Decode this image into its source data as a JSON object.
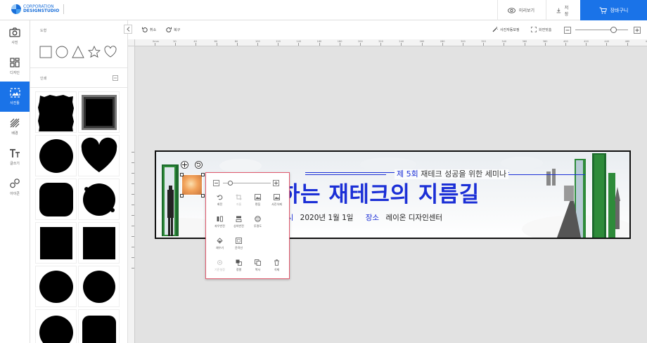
{
  "header": {
    "logo_line1": "CORPORATION",
    "logo_line2": "DESIGNSTUDIO",
    "preview_label": "미리보기",
    "save_label": "저장",
    "cart_label": "장바구니"
  },
  "nav": {
    "items": [
      {
        "label": "사진",
        "icon": "camera-icon"
      },
      {
        "label": "디자인",
        "icon": "layout-grid-icon"
      },
      {
        "label": "사진틀",
        "icon": "photo-frame-icon",
        "active": true
      },
      {
        "label": "배경",
        "icon": "background-pattern-icon"
      },
      {
        "label": "글쓰기",
        "icon": "text-icon"
      },
      {
        "label": "아이콘",
        "icon": "shapes-icon"
      }
    ]
  },
  "panel": {
    "shapes_header": "도형",
    "frames_header": "인쇄"
  },
  "toolbar": {
    "undo_label": "취소",
    "redo_label": "복구",
    "auto_correct_label": "사진자동보정",
    "fit_label": "화면맞춤",
    "zoom_level": 0.73
  },
  "ruler": {
    "marks": [
      "0mm",
      "20",
      "40",
      "60",
      "80",
      "100",
      "120",
      "140",
      "160",
      "180",
      "200",
      "220",
      "240",
      "260",
      "280",
      "300",
      "320",
      "340",
      "360",
      "380",
      "400",
      "420",
      "440",
      "460",
      "480"
    ]
  },
  "banner": {
    "edition_prefix": "제 5회",
    "edition_rest": "재테크 성공을 위한 세미나",
    "headline": "하는 재테크의 지름길",
    "date_label": "일시",
    "date_value": "2020년 1월 1일",
    "place_label": "장소",
    "place_value": "레이온 디자인센터"
  },
  "context_menu": {
    "opacity_level": 0.15,
    "items": [
      {
        "label": "회전",
        "icon": "rotate-icon",
        "enabled": true
      },
      {
        "label": "자름",
        "icon": "crop-icon",
        "enabled": false
      },
      {
        "label": "편집",
        "icon": "image-edit-icon",
        "enabled": true
      },
      {
        "label": "사진삭제",
        "icon": "image-delete-icon",
        "enabled": true
      },
      {
        "label": "좌우반전",
        "icon": "flip-horizontal-icon",
        "enabled": true
      },
      {
        "label": "상하반전",
        "icon": "flip-vertical-icon",
        "enabled": true
      },
      {
        "label": "투명도",
        "icon": "opacity-icon",
        "enabled": true
      },
      {
        "label": "",
        "icon": "",
        "enabled": true
      },
      {
        "label": "채우기",
        "icon": "fill-icon",
        "enabled": true
      },
      {
        "label": "윤곽선",
        "icon": "outline-icon",
        "enabled": true
      },
      {
        "label": "",
        "icon": "",
        "enabled": true
      },
      {
        "label": "",
        "icon": "",
        "enabled": true
      },
      {
        "label": "기준설정",
        "icon": "anchor-icon",
        "enabled": false
      },
      {
        "label": "정렬",
        "icon": "align-icon",
        "enabled": true
      },
      {
        "label": "복사",
        "icon": "copy-icon",
        "enabled": true
      },
      {
        "label": "삭제",
        "icon": "trash-icon",
        "enabled": true
      }
    ]
  },
  "colors": {
    "accent": "#1a73e8",
    "headline": "#1b2fd6",
    "menu_border": "#e05a6e",
    "door_green": "#2e8b3a"
  }
}
